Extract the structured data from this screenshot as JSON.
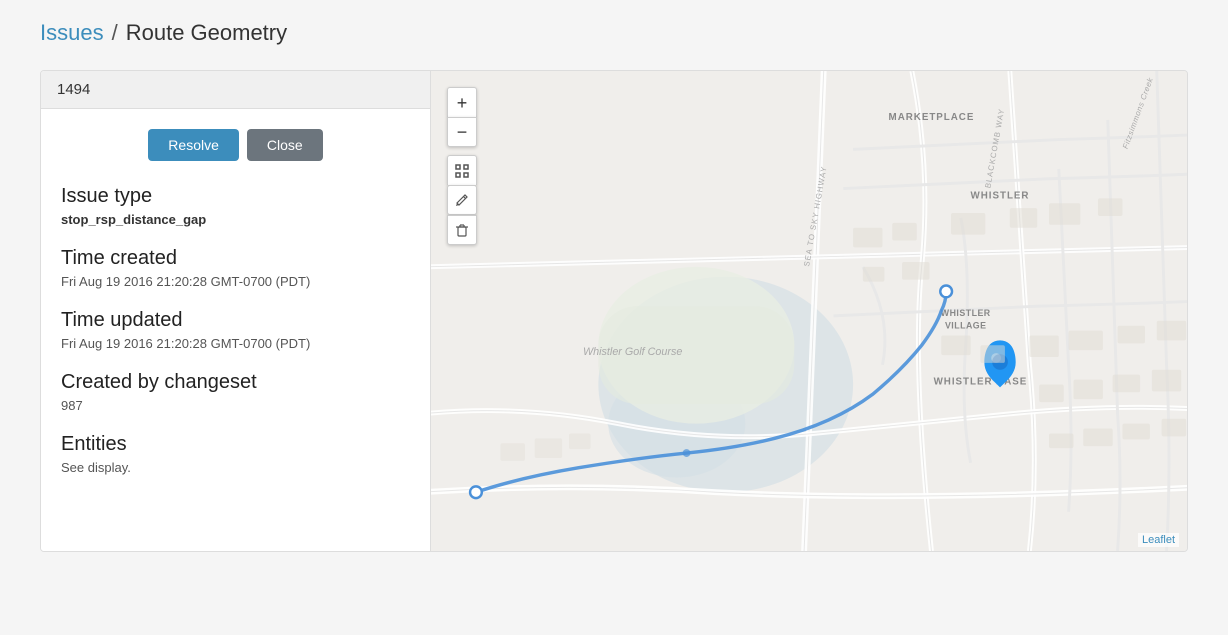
{
  "breadcrumb": {
    "issues_label": "Issues",
    "separator": "/",
    "current_label": "Route Geometry"
  },
  "panel": {
    "header_id": "1494",
    "resolve_button": "Resolve",
    "close_button": "Close",
    "issue_type_label": "Issue type",
    "issue_type_value": "stop_rsp_distance_gap",
    "time_created_label": "Time created",
    "time_created_value": "Fri Aug 19 2016 21:20:28 GMT-0700 (PDT)",
    "time_updated_label": "Time updated",
    "time_updated_value": "Fri Aug 19 2016 21:20:28 GMT-0700 (PDT)",
    "created_by_label": "Created by changeset",
    "created_by_value": "987",
    "entities_label": "Entities",
    "entities_value": "See display."
  },
  "map": {
    "leaflet_label": "Leaflet",
    "place_marketplace": "MARKETPLACE",
    "place_whistler": "WHISTLER",
    "place_whistler_village": "WHISTLER\nVILLAGE",
    "place_whistler_base": "WHISTLER BASE",
    "place_golf": "Whistler Golf Course"
  },
  "controls": {
    "zoom_in": "+",
    "zoom_out": "−",
    "fullscreen": "⛶",
    "edit": "✎",
    "delete": "🗑"
  }
}
